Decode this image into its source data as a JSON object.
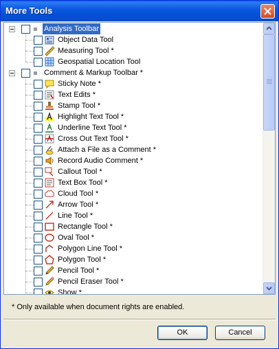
{
  "window": {
    "title": "More Tools",
    "close_icon": "close-icon"
  },
  "tree": {
    "groups": [
      {
        "label": "Analysis Toolbar",
        "selected": true,
        "items": [
          {
            "label": "Object Data Tool",
            "icon": "object-data-icon"
          },
          {
            "label": "Measuring Tool *",
            "icon": "ruler-icon"
          },
          {
            "label": "Geospatial Location Tool",
            "icon": "geospatial-grid-icon"
          }
        ]
      },
      {
        "label": "Comment & Markup Toolbar *",
        "selected": false,
        "items": [
          {
            "label": "Sticky Note *",
            "icon": "sticky-note-icon"
          },
          {
            "label": "Text Edits *",
            "icon": "text-edits-icon"
          },
          {
            "label": "Stamp Tool *",
            "icon": "stamp-icon"
          },
          {
            "label": "Highlight Text Tool *",
            "icon": "highlight-text-icon"
          },
          {
            "label": "Underline Text Tool *",
            "icon": "underline-text-icon"
          },
          {
            "label": "Cross Out Text Tool *",
            "icon": "cross-out-text-icon"
          },
          {
            "label": "Attach a File as a Comment *",
            "icon": "paperclip-icon"
          },
          {
            "label": "Record Audio Comment *",
            "icon": "audio-comment-icon"
          },
          {
            "label": "Callout Tool *",
            "icon": "callout-icon"
          },
          {
            "label": "Text Box Tool *",
            "icon": "text-box-icon"
          },
          {
            "label": "Cloud Tool *",
            "icon": "cloud-icon"
          },
          {
            "label": "Arrow Tool *",
            "icon": "arrow-icon"
          },
          {
            "label": "Line Tool *",
            "icon": "line-icon"
          },
          {
            "label": "Rectangle Tool *",
            "icon": "rectangle-icon"
          },
          {
            "label": "Oval Tool *",
            "icon": "oval-icon"
          },
          {
            "label": "Polygon Line Tool *",
            "icon": "polygon-line-icon"
          },
          {
            "label": "Polygon Tool *",
            "icon": "polygon-icon"
          },
          {
            "label": "Pencil Tool *",
            "icon": "pencil-icon"
          },
          {
            "label": "Pencil Eraser Tool *",
            "icon": "pencil-eraser-icon"
          },
          {
            "label": "Show *",
            "icon": "show-icon"
          }
        ]
      }
    ]
  },
  "footer": {
    "note": "* Only available when document rights are enabled."
  },
  "buttons": {
    "ok": "OK",
    "cancel": "Cancel"
  }
}
